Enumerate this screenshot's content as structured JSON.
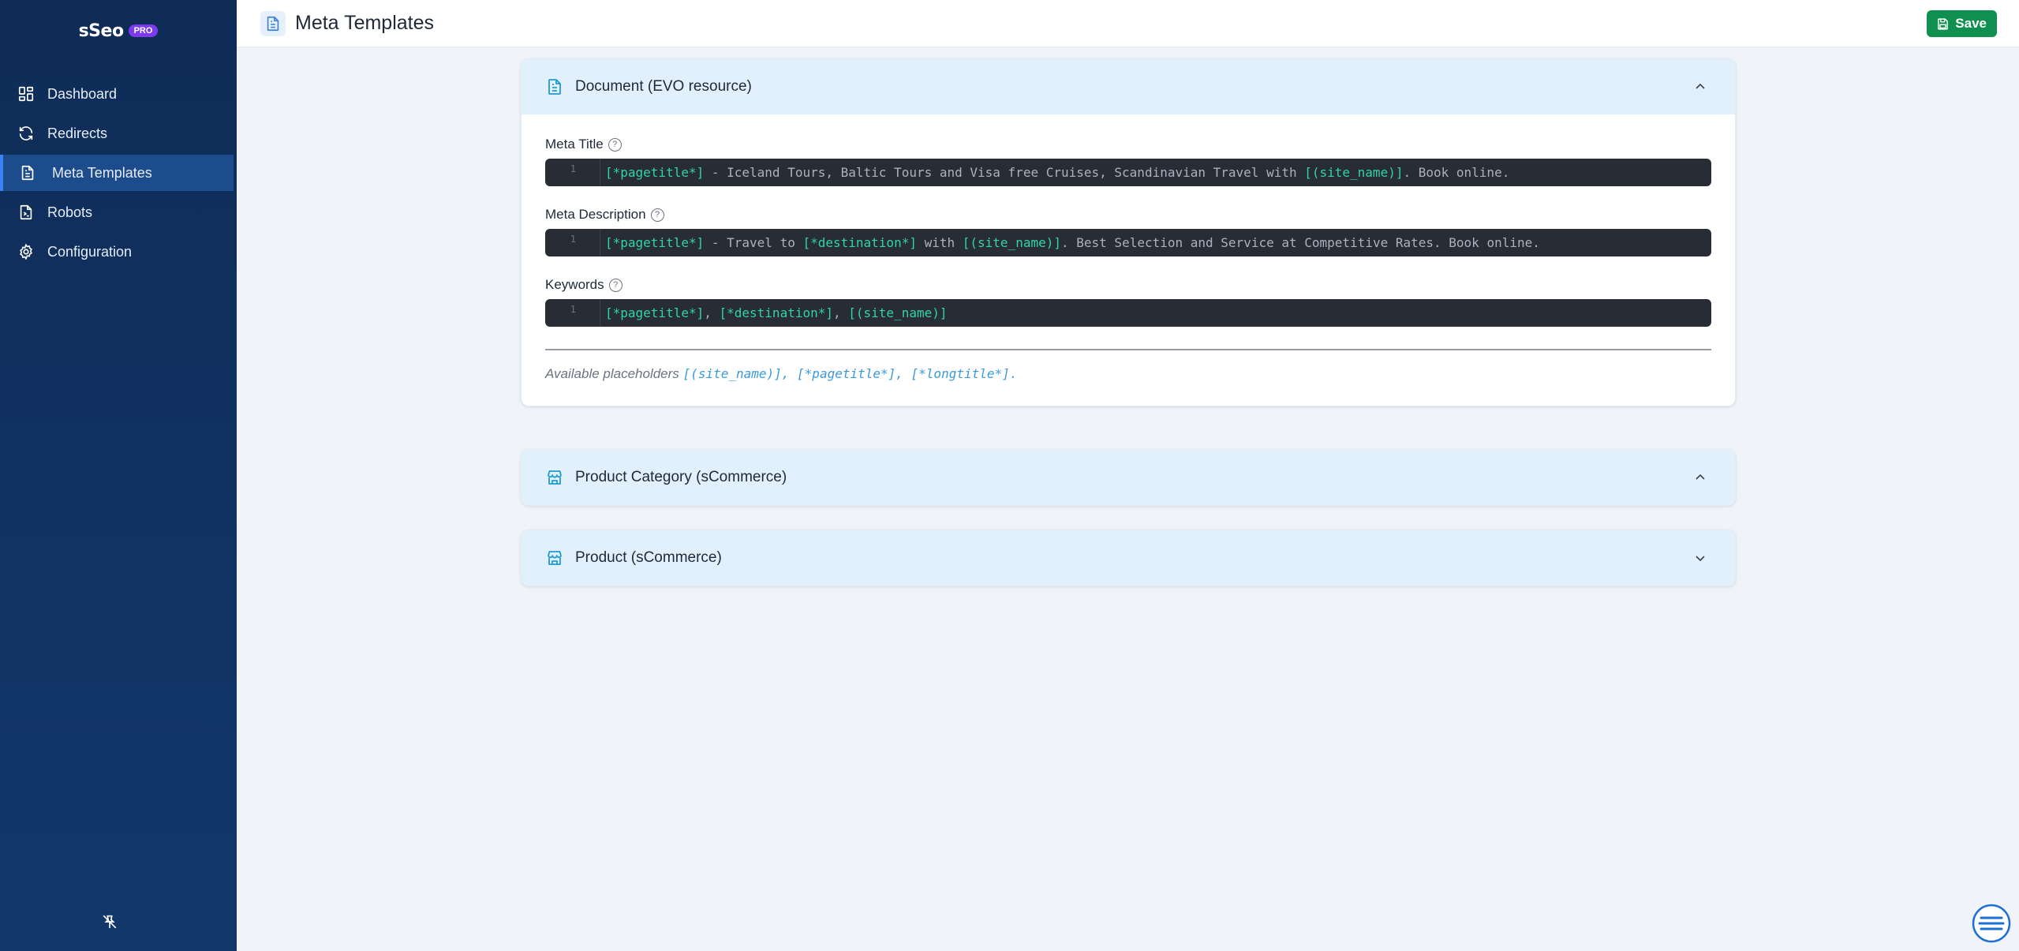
{
  "brand": {
    "name": "sSeo",
    "badge": "PRO"
  },
  "sidebar": {
    "items": [
      {
        "label": "Dashboard",
        "icon": "dashboard-icon"
      },
      {
        "label": "Redirects",
        "icon": "refresh-icon"
      },
      {
        "label": "Meta Templates",
        "icon": "document-icon",
        "active": true
      },
      {
        "label": "Robots",
        "icon": "robot-file-icon"
      },
      {
        "label": "Configuration",
        "icon": "gear-icon"
      }
    ]
  },
  "header": {
    "title": "Meta Templates",
    "save_label": "Save"
  },
  "panels": [
    {
      "title": "Document (EVO resource)",
      "expanded": true,
      "fields": [
        {
          "label": "Meta Title",
          "line": "1",
          "parts": [
            "[*pagetitle*]",
            " - Iceland Tours, Baltic Tours and Visa free Cruises, Scandinavian Travel with ",
            "[(site_name)]",
            ". Book online."
          ]
        },
        {
          "label": "Meta Description",
          "line": "1",
          "parts": [
            "[*pagetitle*]",
            " - Travel to ",
            "[*destination*]",
            " with ",
            "[(site_name)]",
            ". Best Selection and Service at Competitive Rates. Book online."
          ]
        },
        {
          "label": "Keywords",
          "line": "1",
          "parts": [
            "[*pagetitle*]",
            ", ",
            "[*destination*]",
            ", ",
            "[(site_name)]"
          ]
        }
      ],
      "available_text": "Available placeholders",
      "available_placeholders": "[(site_name)], [*pagetitle*], [*longtitle*]."
    },
    {
      "title": "Product Category (sCommerce)",
      "expanded": true
    },
    {
      "title": "Product (sCommerce)",
      "expanded": false
    }
  ],
  "colors": {
    "accent": "#10904f",
    "sidebar": "#0f2c57",
    "placeholder": "#2fd5a8"
  }
}
